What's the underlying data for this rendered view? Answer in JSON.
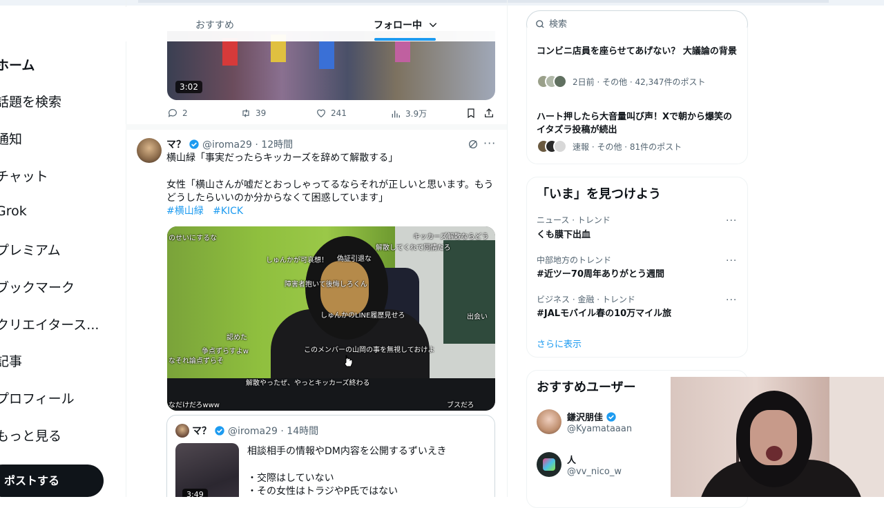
{
  "nav": {
    "home": "ホーム",
    "explore": "話題を検索",
    "notifications": "通知",
    "chat": "チャット",
    "grok": "Grok",
    "premium": "プレミアム",
    "bookmarks": "ブックマーク",
    "creator": "クリエイタース...",
    "articles": "記事",
    "profile": "プロフィール",
    "more": "もっと見る",
    "post_button": "ポストする"
  },
  "tabs": {
    "recommended": "おすすめ",
    "following": "フォロー中"
  },
  "prev_post": {
    "duration": "3:02",
    "replies": "2",
    "reposts": "39",
    "likes": "241",
    "views": "3.9万"
  },
  "post": {
    "name": "マ？",
    "meta": "@iroma29 · 12時間",
    "line1": "横山緑「事実だったらキッカーズを辞めて解散する」",
    "line2": "女性「横山さんが嘘だとおっしゃってるならそれが正しいと思います。もう",
    "line3": "どうしたらいいのか分からなくて困惑しています」",
    "hashtag1": "#横山緑",
    "hashtag2": "#KICK",
    "overlays": [
      "のせいにするな",
      "しゅんかが可哀想！",
      "偽証引退な",
      "障害者抱いて後悔しろくん",
      "キッカーズ解散ならどう",
      "解散してくれて同情だろ",
      "しゅんかのLINE履歴見せろ",
      "認めた",
      "争点ずらすよw",
      "なそれ論点ずらそ",
      "このメンバーの山岡の事を無視しておけよ",
      "解散やったぜ、やっとキッカーズ終わる",
      "なだけだろwww",
      "出会い",
      "ブスだろ"
    ]
  },
  "quote": {
    "name": "マ？",
    "meta": "@iroma29 · 14時間",
    "line1": "相談相手の情報やDM内容を公開するずいえき",
    "line2": "・交際はしていない",
    "line3": "・その女性はトラジやP氏ではない",
    "duration": "3:49"
  },
  "search": {
    "placeholder": "検索"
  },
  "news": [
    {
      "title": "コンビニ店員を座らせてあげない？ 大議論の背景",
      "meta": "2日前 · その他 · 42,347件のポスト"
    },
    {
      "title": "ハート押したら大音量叫び声！Xで朝から爆笑のイタズラ投稿が続出",
      "meta": "速報 · その他 · 81件のポスト"
    }
  ],
  "trends": {
    "title": "「いま」を見つけよう",
    "items": [
      {
        "category": "ニュース · トレンド",
        "name": "くも膜下出血"
      },
      {
        "category": "中部地方のトレンド",
        "name": "#近ツー70周年ありがとう週間"
      },
      {
        "category": "ビジネス · 金融 · トレンド",
        "name": "#JALモバイル春の10万マイル旅"
      }
    ],
    "show_more": "さらに表示"
  },
  "who_to_follow": {
    "title": "おすすめユーザー",
    "users": [
      {
        "name": "鎌沢朋佳",
        "handle": "@Kyamataaan"
      },
      {
        "name": "人",
        "handle": "@vv_nico_w"
      }
    ]
  },
  "colors": {
    "accent": "#1d9bf0",
    "text": "#0f1419",
    "muted": "#536471"
  }
}
